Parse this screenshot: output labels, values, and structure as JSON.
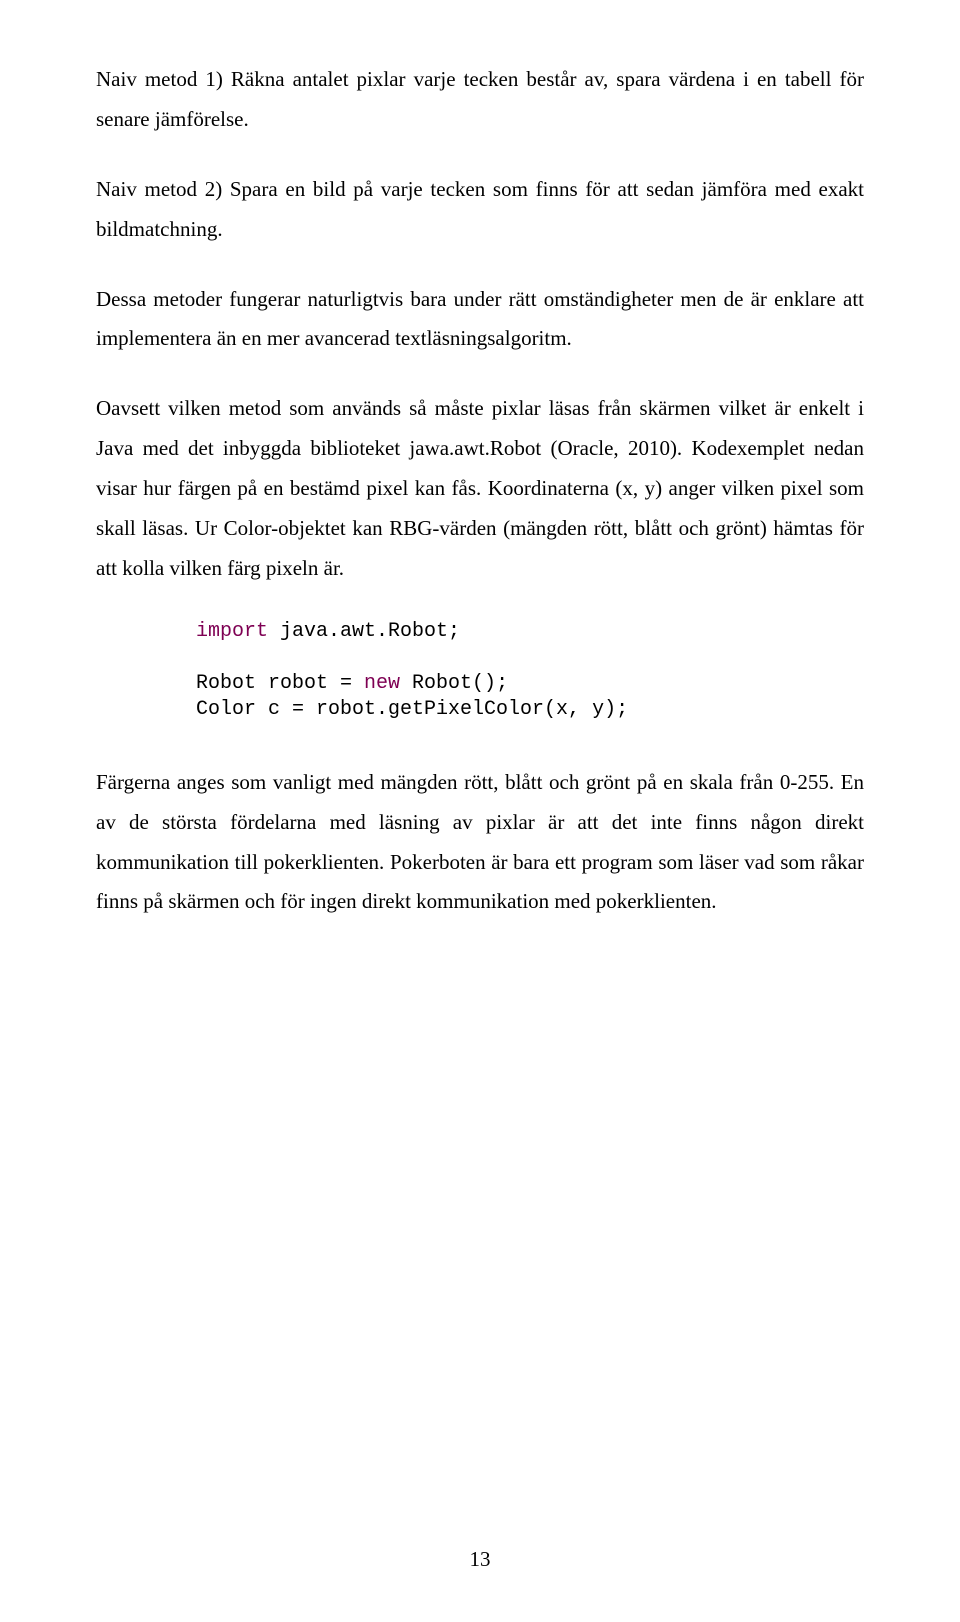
{
  "paragraphs": {
    "p1": "Naiv metod 1) Räkna antalet pixlar varje tecken består av, spara värdena i en tabell för senare jämförelse.",
    "p2": "Naiv metod 2) Spara en bild på varje tecken som finns för att sedan jämföra med exakt bildmatchning.",
    "p3": "Dessa metoder fungerar naturligtvis bara under rätt omständigheter men de är enklare att implementera än en mer avancerad textläsningsalgoritm.",
    "p4": "Oavsett vilken metod som används så måste pixlar läsas från skärmen vilket är enkelt i Java med det inbyggda biblioteket jawa.awt.Robot (Oracle, 2010). Kodexemplet nedan visar hur färgen på en bestämd pixel kan fås. Koordinaterna (x, y) anger vilken pixel som skall läsas. Ur Color-objektet kan RBG-värden (mängden rött, blått och grönt) hämtas för att kolla vilken färg pixeln är.",
    "p5": "Färgerna anges som vanligt med mängden rött, blått och grönt på en skala från 0-255. En av de största fördelarna med läsning av pixlar är att det inte finns någon direkt kommunikation till pokerklienten. Pokerboten är bara ett program som läser vad som råkar finns på skärmen och för ingen direkt kommunikation med pokerklienten."
  },
  "code": {
    "kw_import": "import",
    "import_rest": " java.awt.Robot;",
    "line2_a": "Robot robot = ",
    "kw_new": "new",
    "line2_b": " Robot();",
    "line3": "Color c = robot.getPixelColor(x, y);"
  },
  "page_number": "13"
}
